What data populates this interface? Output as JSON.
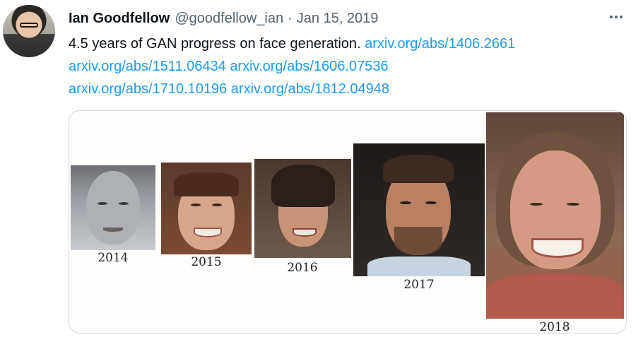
{
  "tweet": {
    "author_name": "Ian Goodfellow",
    "handle": "@goodfellow_ian",
    "separator": "·",
    "date": "Jan 15, 2019",
    "text_prefix": "4.5 years of GAN progress on face generation.",
    "links": [
      "arxiv.org/abs/1406.2661",
      "arxiv.org/abs/1511.06434",
      "arxiv.org/abs/1606.07536",
      "arxiv.org/abs/1710.10196",
      "arxiv.org/abs/1812.04948"
    ]
  },
  "media": {
    "years": [
      "2014",
      "2015",
      "2016",
      "2017",
      "2018"
    ]
  },
  "icons": {
    "more": "more-horizontal-icon"
  },
  "colors": {
    "link": "#1d9bf0",
    "secondary_text": "#536471",
    "border": "#cfd9de"
  }
}
